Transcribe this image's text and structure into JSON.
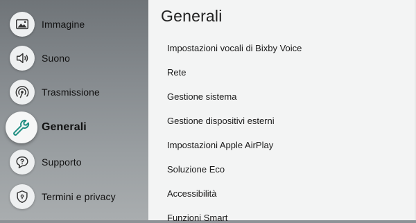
{
  "sidebar": {
    "items": [
      {
        "label": "Immagine",
        "icon": "picture-icon"
      },
      {
        "label": "Suono",
        "icon": "speaker-icon"
      },
      {
        "label": "Trasmissione",
        "icon": "broadcast-icon"
      },
      {
        "label": "Generali",
        "icon": "wrench-icon",
        "selected": true
      },
      {
        "label": "Supporto",
        "icon": "support-chat-icon"
      },
      {
        "label": "Termini e privacy",
        "icon": "shield-lock-icon"
      }
    ]
  },
  "panel": {
    "title": "Generali",
    "items": [
      "Impostazioni vocali di Bixby Voice",
      "Rete",
      "Gestione sistema",
      "Gestione dispositivi esterni",
      "Impostazioni Apple AirPlay",
      "Soluzione Eco",
      "Accessibilità",
      "Funzioni Smart"
    ]
  },
  "colors": {
    "sidebar_bg": "#858a8e",
    "panel_bg": "#f3f4f4",
    "selected_icon": "#1f8f82"
  }
}
